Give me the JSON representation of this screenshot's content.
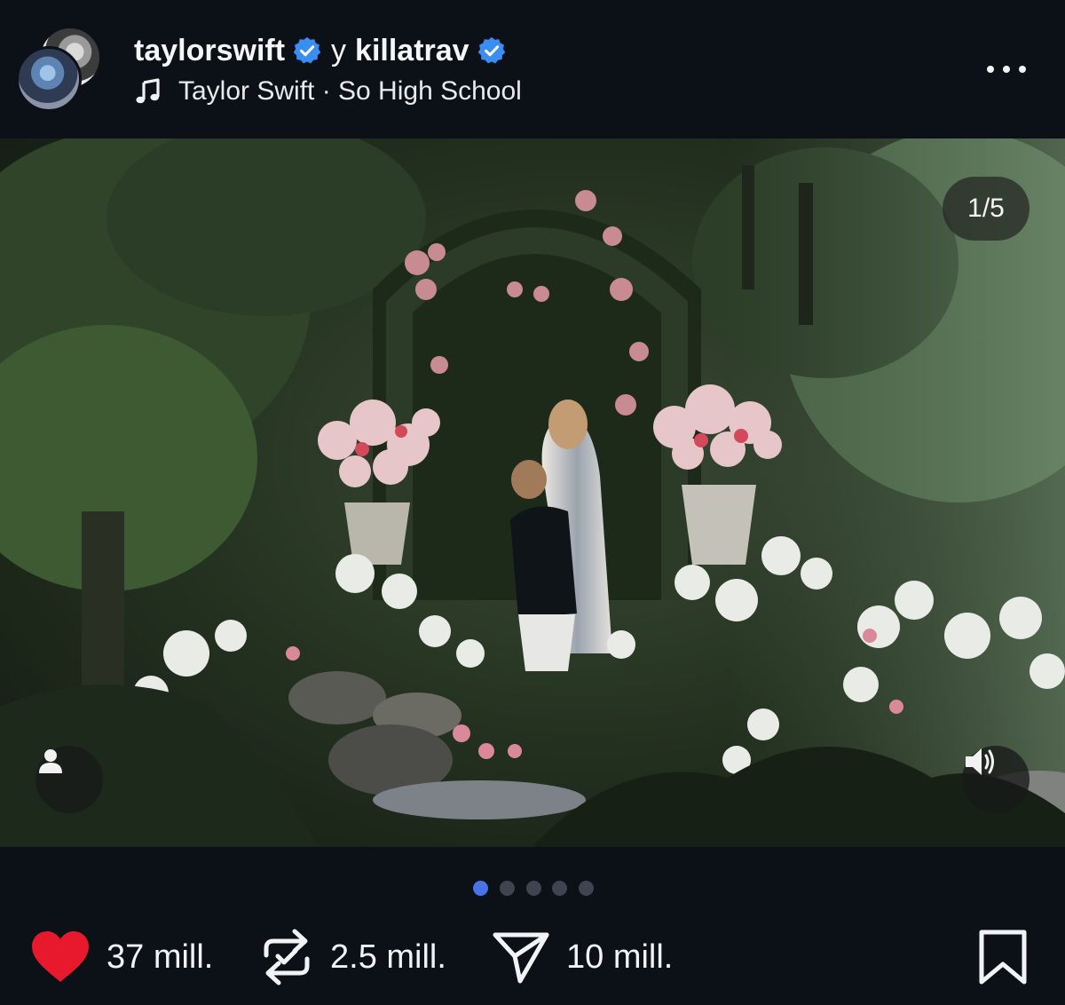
{
  "header": {
    "user1": "taylorswift",
    "conjunction": "y",
    "user2": "killatrav",
    "song": "Taylor Swift · So High School"
  },
  "media": {
    "counter": "1/5",
    "slide_count": 5,
    "active_slide": 1
  },
  "actions": {
    "likes": "37 mill.",
    "reposts": "2.5 mill.",
    "shares": "10 mill."
  },
  "colors": {
    "background": "#0c1017",
    "verified": "#3a8df2",
    "like": "#e8192c",
    "active_dot": "#4a73e8",
    "inactive_dot": "#3f4550"
  },
  "icons": [
    "verified-badge-icon",
    "music-note-icon",
    "more-icon",
    "person-icon",
    "volume-icon",
    "heart-icon",
    "repost-icon",
    "share-icon",
    "bookmark-icon"
  ]
}
